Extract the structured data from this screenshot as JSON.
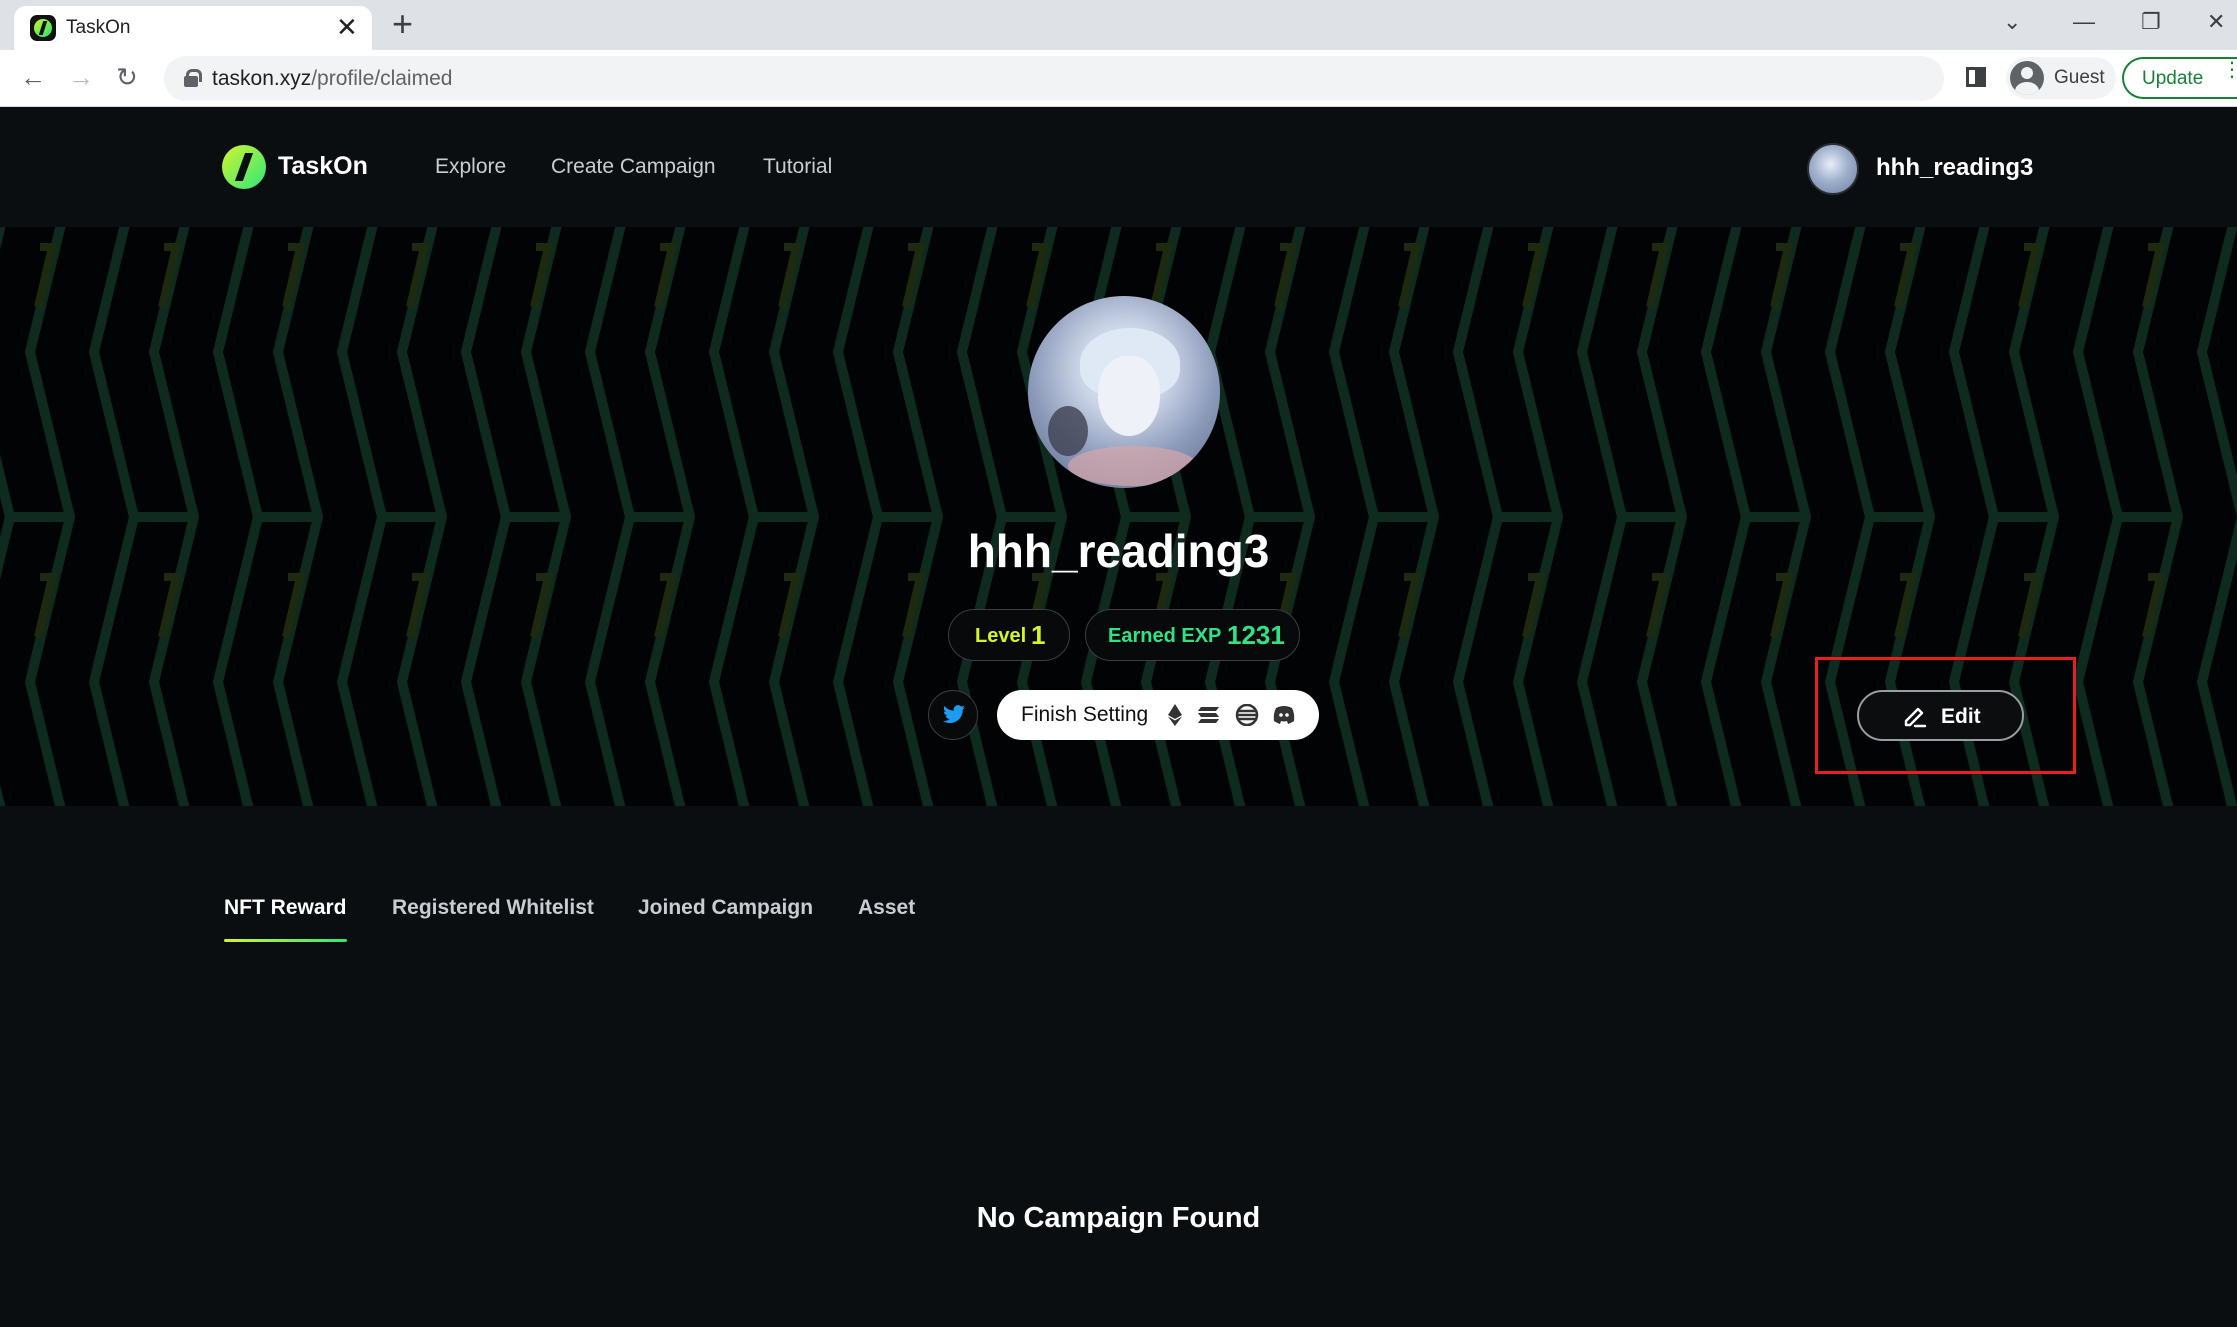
{
  "browser": {
    "tab_title": "TaskOn",
    "tab_close": "✕",
    "new_tab": "+",
    "url_domain": "taskon.xyz",
    "url_path": "/profile/claimed",
    "profile_label": "Guest",
    "update_label": "Update",
    "window_controls": [
      "⌄",
      "—",
      "❐",
      "✕"
    ]
  },
  "site": {
    "brand": "TaskOn",
    "nav": [
      "Explore",
      "Create Campaign",
      "Tutorial"
    ],
    "username": "hhh_reading3"
  },
  "profile": {
    "name": "hhh_reading3",
    "level_label": "Level",
    "level_value": "1",
    "exp_label": "Earned EXP",
    "exp_value": "1231",
    "finish_setting_label": "Finish Setting",
    "edit_label": "Edit",
    "accent_yellow": "#d7f523",
    "accent_green": "#2fe285",
    "highlight_color": "#e8201d"
  },
  "tabs": {
    "items": [
      "NFT Reward",
      "Registered Whitelist",
      "Joined Campaign",
      "Asset"
    ],
    "active_index": 0
  },
  "content": {
    "empty_message": "No Campaign Found"
  }
}
